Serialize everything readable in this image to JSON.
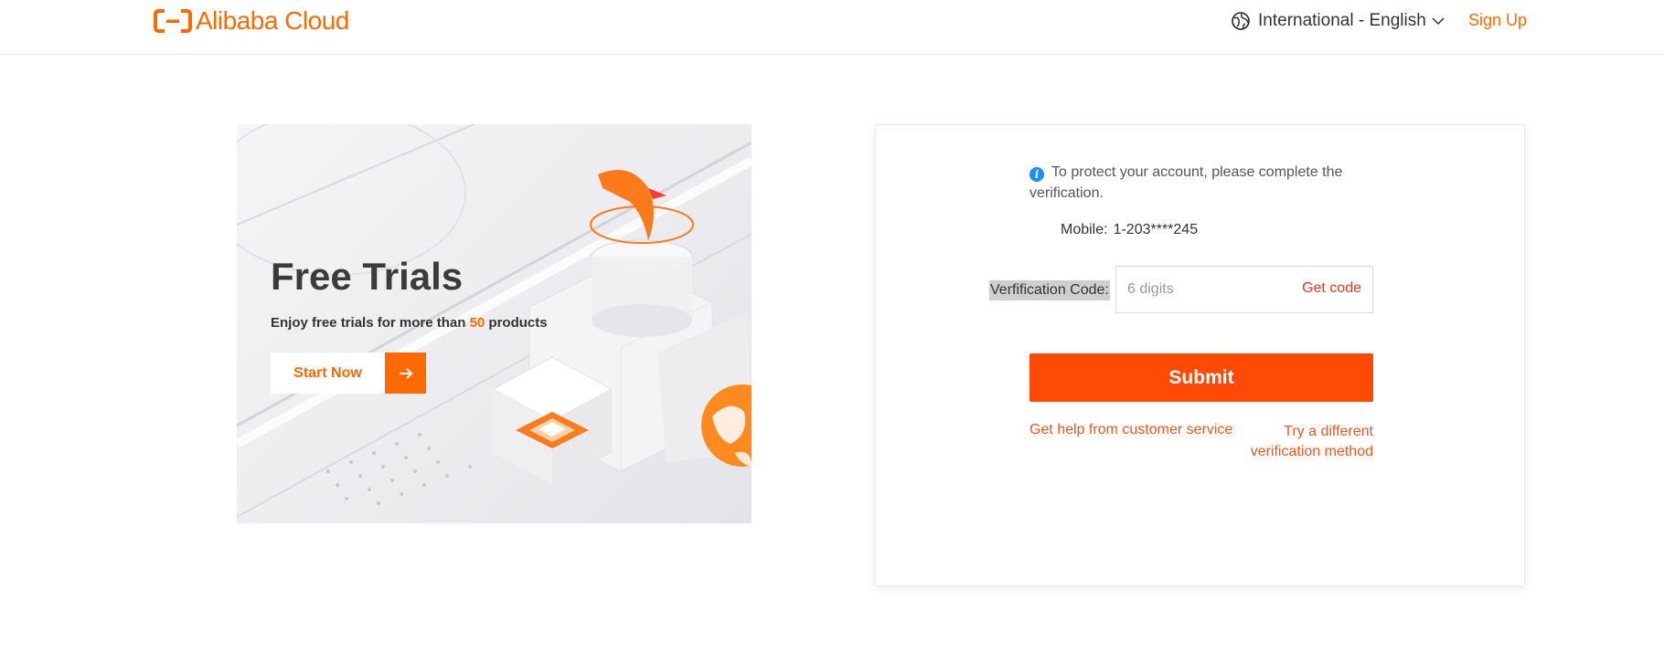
{
  "header": {
    "brand": "Alibaba Cloud",
    "language": "International - English",
    "signup_label": "Sign Up",
    "icons": [
      "alibaba-cloud-logo",
      "globe-icon",
      "chevron-down-icon"
    ]
  },
  "banner": {
    "title": "Free Trials",
    "subtitle_prefix": "Enjoy free trials for more than ",
    "subtitle_highlight": "50",
    "subtitle_suffix": " products",
    "button_label": "Start Now"
  },
  "verify": {
    "notice": "To protect your account, please complete the verification.",
    "mobile_label": "Mobile:",
    "mobile_value": "1-203****245",
    "code_label": "Verfification Code:",
    "code_placeholder": "6 digits",
    "get_code_label": "Get code",
    "submit_label": "Submit",
    "help_link": "Get help from customer service",
    "alt_method_link": "Try a different verification method"
  },
  "colors": {
    "brand_orange": "#ff6a00",
    "submit_bg": "#ff4a05",
    "link_red": "#e85a22",
    "info_blue": "#1a8fff"
  }
}
